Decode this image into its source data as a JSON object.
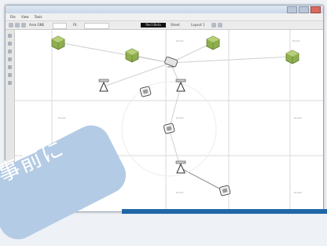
{
  "window": {
    "menu": [
      "File",
      "View",
      "Tools"
    ]
  },
  "toolbar": {
    "label_a": "Area ONE",
    "label_b": "Fit",
    "dark_field": "Rect Beta",
    "label_c": "Sheet",
    "label_d": "Layout 1"
  },
  "canvas": {
    "zone_labels": [
      "Zone1",
      "Zone2",
      "Zone3",
      "Zone4",
      "Zone5",
      "Zone6",
      "Zone7",
      "Zone8"
    ]
  },
  "overlay": {
    "sticker_text": "事前に"
  },
  "colors": {
    "server_green": "#8fae4e",
    "sticker_blue": "#b4cbe5",
    "bottom_strip": "#1f67a6"
  }
}
